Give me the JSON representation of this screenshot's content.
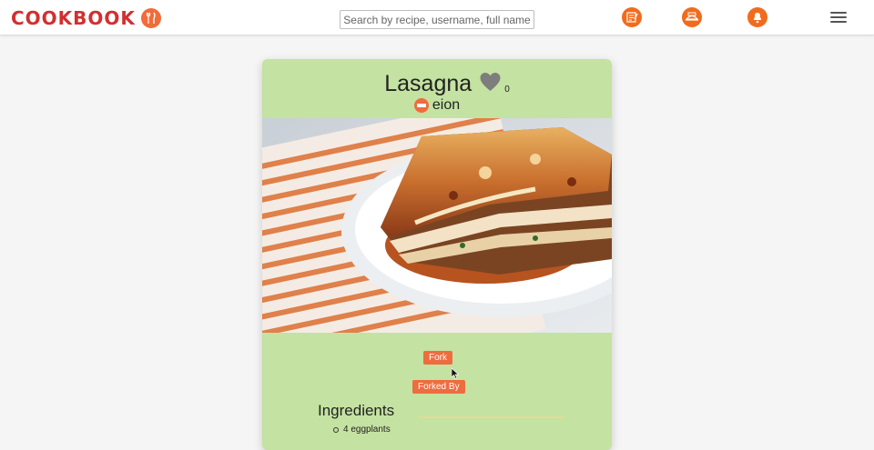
{
  "navbar": {
    "brand": "COOKBOOK",
    "search_placeholder": "Search by recipe, username, full name",
    "icons": [
      "new-recipe-icon",
      "feed-icon",
      "notifications-icon",
      "menu-icon"
    ],
    "accent": "#f26b1d",
    "brand_color": "#d32f2f"
  },
  "recipe": {
    "title": "Lasagna",
    "likes": "0",
    "author": "eion",
    "card_color": "#c4e2a1",
    "fork_label": "Fork",
    "forked_by_label": "Forked By",
    "ingredients_heading": "Ingredients",
    "ingredients": [
      "4 eggplants"
    ]
  }
}
